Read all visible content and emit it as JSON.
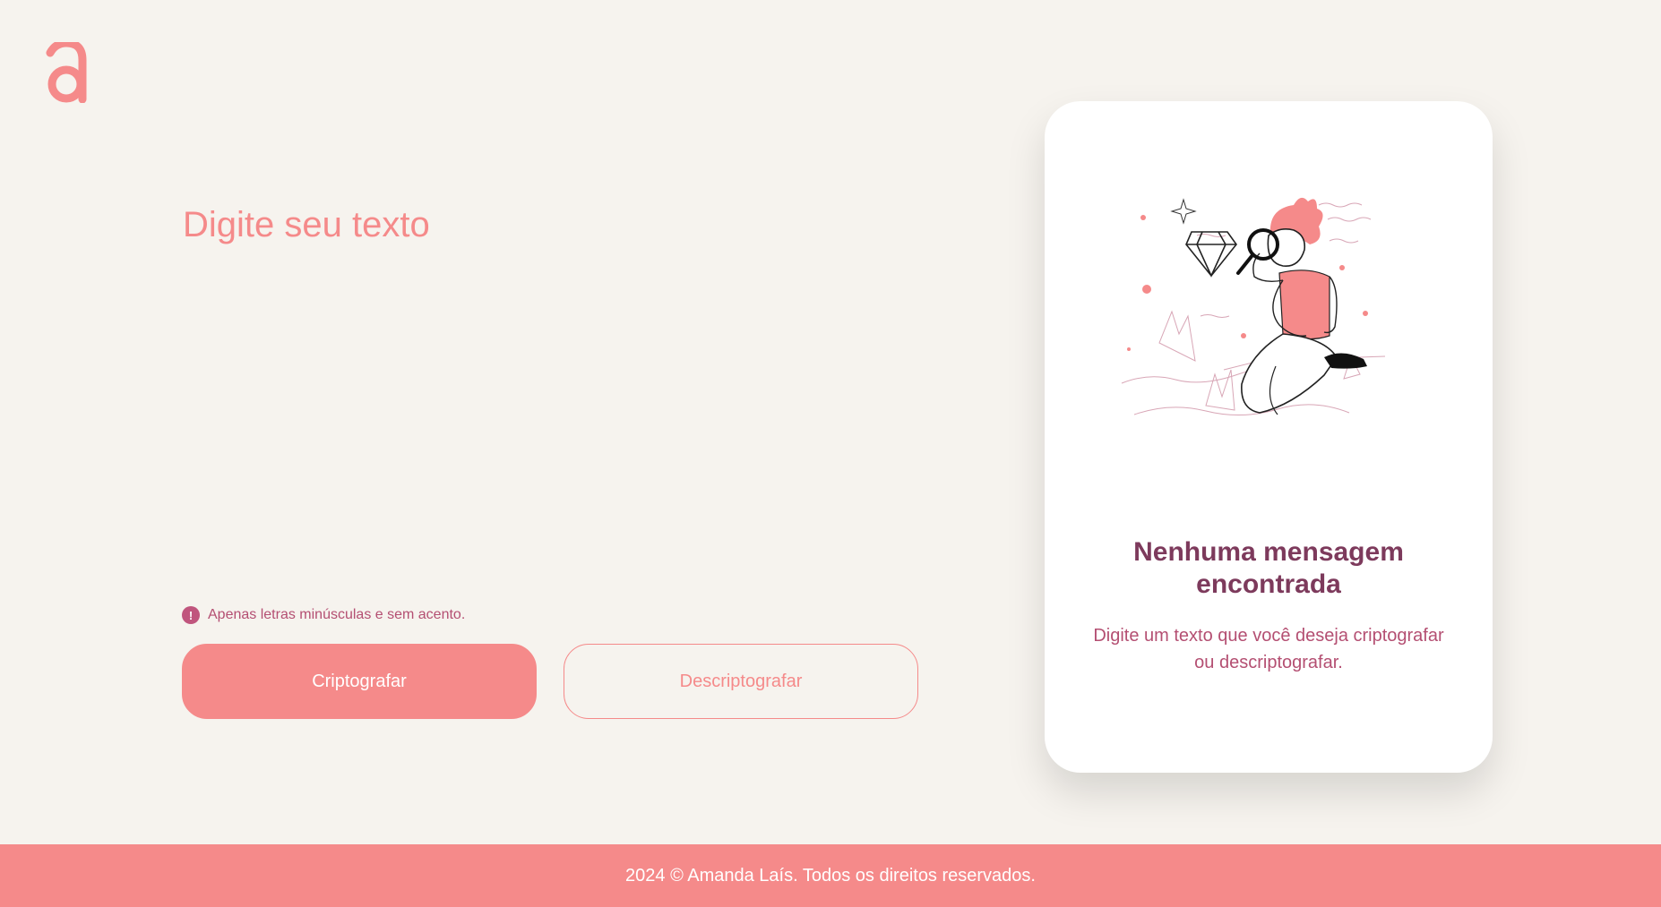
{
  "logo": {
    "icon": "logo-a-icon",
    "color": "#f58a8a"
  },
  "editor": {
    "placeholder": "Digite seu texto",
    "value": ""
  },
  "hint": {
    "icon": "exclamation-circle-icon",
    "text": "Apenas letras minúsculas e sem acento."
  },
  "actions": {
    "encrypt_label": "Criptografar",
    "decrypt_label": "Descriptografar"
  },
  "output_card": {
    "illustration": "person-magnifying-glass-diamond-illustration",
    "title": "Nenhuma mensagem encontrada",
    "text": "Digite um texto que você deseja criptografar ou descriptografar."
  },
  "footer": {
    "text": "2024 © Amanda Laís. Todos os direitos reservados."
  },
  "colors": {
    "background": "#f6f3ee",
    "accent": "#f58a8a",
    "title": "#7d3a5c",
    "text": "#b44f72",
    "card": "#ffffff"
  }
}
